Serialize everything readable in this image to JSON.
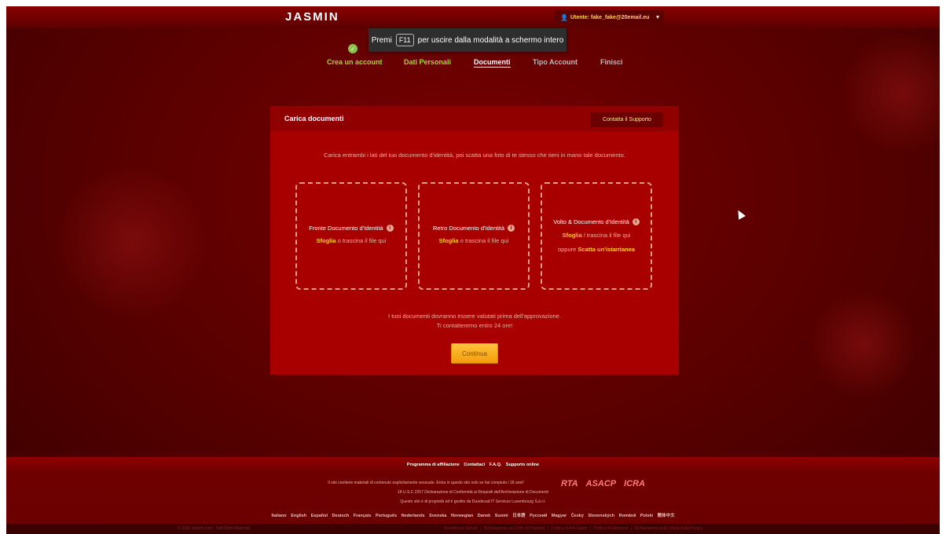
{
  "header": {
    "logo": "JASMIN",
    "user_menu": "Utente: fake_fake@20email.eu",
    "fullscreen_toast": {
      "before": "Premi",
      "key": "F11",
      "after": "per uscire dalla modalità a schermo intero"
    }
  },
  "steps": [
    {
      "label": "Crea un account",
      "state": "done"
    },
    {
      "label": "Dati Personali",
      "state": "done"
    },
    {
      "label": "Documenti",
      "state": "active"
    },
    {
      "label": "Tipo Account",
      "state": "pending"
    },
    {
      "label": "Finisci",
      "state": "pending"
    }
  ],
  "card": {
    "title": "Carica documenti",
    "support_button": "Contatta il Supporto",
    "instructions": "Carica entrambi i lati del tuo documento d'identità, poi scatta una foto di te stesso che tieni in mano tale documento.",
    "dropzones": [
      {
        "title": "Fronte Documento d'Identità",
        "browse": "Sfoglia",
        "rest": "o trascina il file qui"
      },
      {
        "title": "Retro Documento d'Identità",
        "browse": "Sfoglia",
        "rest": "o trascina il file qui"
      },
      {
        "title": "Volto & Documento d'Identità",
        "browse": "Sfoglia",
        "rest": "/ trascina il file qui",
        "or_text": "oppure",
        "snapshot": "Scatta un'istantanea"
      }
    ],
    "review_line1": "I tuoi documenti dovranno essere valutati prima dell'approvazione.",
    "review_line2": "Ti contatteremo entro 24 ore!",
    "continue_button": "Continua"
  },
  "footer": {
    "links": [
      "Programma di affiliazione",
      "Contattaci",
      "F.A.Q.",
      "Supporto online"
    ],
    "line1": "Il sito contiene materiali di contenuto esplicitamente sessuale. Entra in questo sito solo se hai compiuto i 18 anni!",
    "badges": [
      "RTA",
      "ASACP",
      "ICRA"
    ],
    "line2": "18 U.S.C 2257 Dichiarazione di Conformità ai Requisiti dell'Archiviazione di Documenti",
    "line3": "Questo sito è di proprietà ed è gestito da Duodecad IT Services Luxembourg S.à r.l.",
    "languages": [
      "Italiano",
      "English",
      "Español",
      "Deutsch",
      "Français",
      "Português",
      "Nederlands",
      "Svenska",
      "Norwegian",
      "Dansk",
      "Suomi",
      "日本語",
      "Русский",
      "Magyar",
      "Český",
      "Slovenských",
      "Română",
      "Polski",
      "簡体中文"
    ],
    "copyright": "© 2016 Jasmin.com - Tutti Diritti Riservati",
    "legal_links": [
      "Accordo sui Servizi",
      "Dichiarazione sui Diritti di Proprietà",
      "Politica di Anti-Spam",
      "Politica di Rimborso",
      "Dichiarazione sulla Tutela della Privacy"
    ]
  }
}
